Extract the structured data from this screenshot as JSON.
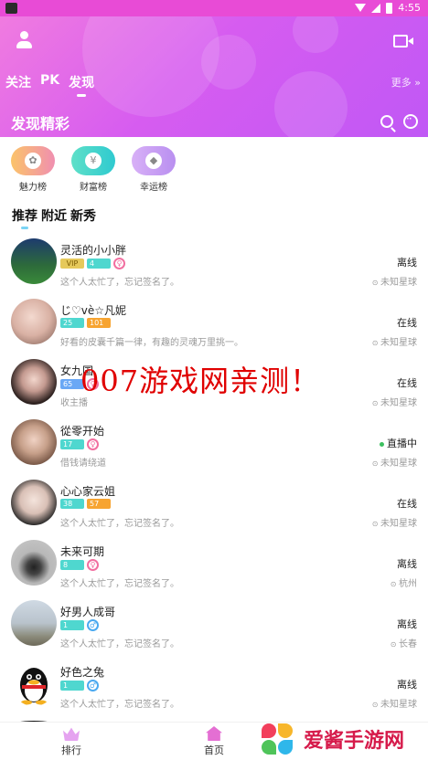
{
  "status_bar": {
    "time": "4:55"
  },
  "header": {
    "tabs": [
      {
        "label": "关注",
        "active": false
      },
      {
        "label": "PK",
        "active": false
      },
      {
        "label": "发现",
        "active": true
      }
    ],
    "more": "更多 »",
    "section_title": "发现精彩",
    "gradient": [
      "#f07be0",
      "#c058f5"
    ]
  },
  "rankings": [
    {
      "label": "魅力榜",
      "color": "#f7a64a",
      "icon": "flower-icon"
    },
    {
      "label": "财富榜",
      "color": "#3fd6c6",
      "icon": "money-bag-icon"
    },
    {
      "label": "幸运榜",
      "color": "#c99af2",
      "icon": "lucky-box-icon"
    }
  ],
  "subtabs": [
    "推荐",
    "附近",
    "新秀"
  ],
  "users": [
    {
      "name": "灵活的小小胖",
      "level": "4",
      "vip": "VIP",
      "gender": "female",
      "signature": "这个人太忙了，忘记签名了。",
      "status": "离线",
      "location": "未知星球",
      "avatar_color": "#3a6b2d"
    },
    {
      "name": "じ♡vè☆凡妮",
      "level": "25",
      "level2": "101",
      "gender": "none",
      "signature": "好看的皮囊千篇一律，有趣的灵魂万里挑一。",
      "status": "在线",
      "location": "未知星球",
      "avatar_color": "#e8c9c1"
    },
    {
      "name": "女九国",
      "level": "65",
      "gender": "female",
      "signature": "收主播",
      "status": "在线",
      "location": "未知星球",
      "avatar_color": "#5a4a48"
    },
    {
      "name": "從零开始",
      "level": "17",
      "gender": "female",
      "signature": "借钱请绕道",
      "status": "直播中",
      "location": "未知星球",
      "avatar_color": "#c7a08a"
    },
    {
      "name": "心心家云姐",
      "level": "38",
      "level2": "57",
      "gender": "none",
      "signature": "这个人太忙了，忘记签名了。",
      "status": "在线",
      "location": "未知星球",
      "avatar_color": "#d9d9d9"
    },
    {
      "name": "未来可期",
      "level": "8",
      "gender": "female",
      "signature": "这个人太忙了，忘记签名了。",
      "status": "离线",
      "location": "杭州",
      "avatar_color": "#9e9e9e"
    },
    {
      "name": "好男人成哥",
      "level": "1",
      "gender": "male",
      "signature": "这个人太忙了，忘记签名了。",
      "status": "离线",
      "location": "长春",
      "avatar_color": "#8a9aa8"
    },
    {
      "name": "好色之兔",
      "level": "1",
      "gender": "male",
      "signature": "这个人太忙了，忘记签名了。",
      "status": "离线",
      "location": "未知星球",
      "avatar_color": "#ffffff"
    }
  ],
  "bottom_nav": [
    {
      "label": "排行",
      "icon": "crown-icon",
      "color": "#e5a3f0"
    },
    {
      "label": "首页",
      "icon": "home-icon",
      "color": "#e46fd3"
    }
  ],
  "watermark": "007游戏网亲测！",
  "brand": "爱酱手游网"
}
